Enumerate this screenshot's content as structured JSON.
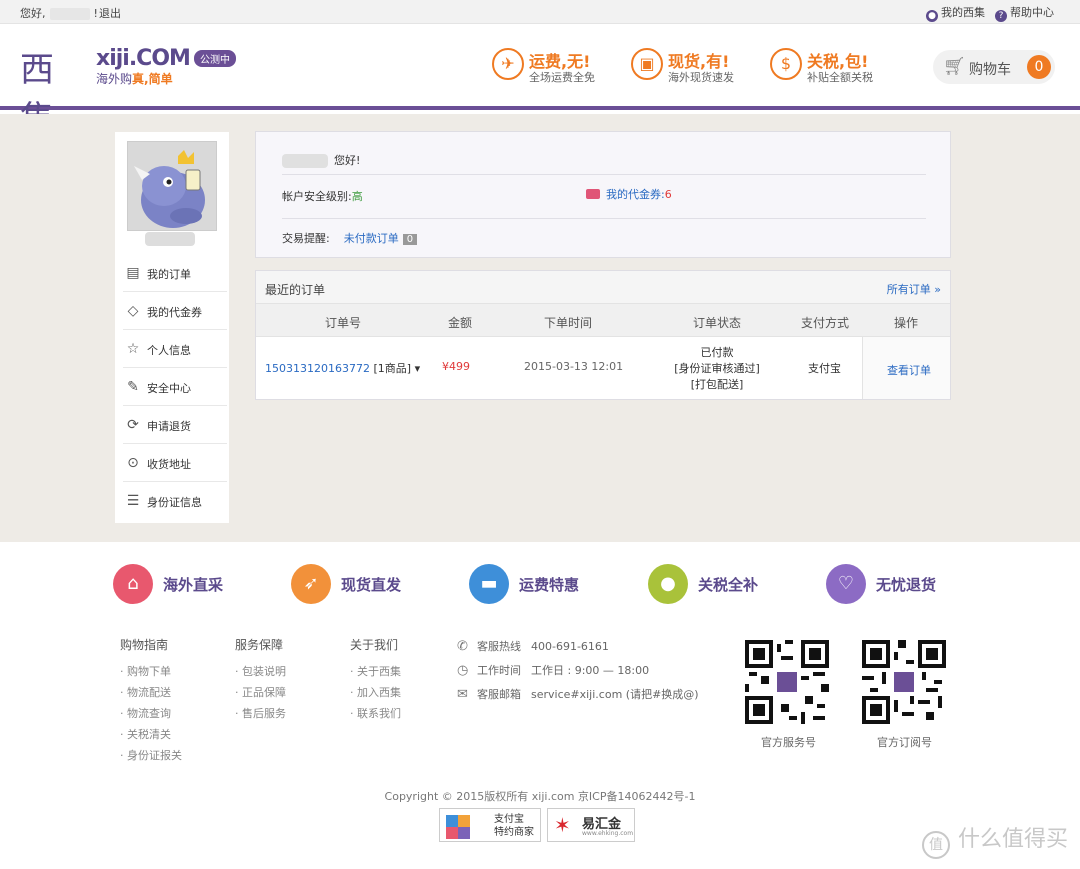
{
  "topbar": {
    "greeting": "您好,",
    "greeting_end": "!",
    "logout": "退出",
    "my_xiji": "我的西集",
    "help": "帮助中心"
  },
  "header": {
    "logo_cn": "西集",
    "logo_en": "xiji.COM",
    "slogan_a": "海外购",
    "slogan_b": "真,",
    "slogan_c": "简单",
    "beta": "公测中",
    "promos": [
      {
        "title": "运费,无!",
        "sub": "全场运费全免",
        "icon": "plane-icon"
      },
      {
        "title": "现货,有!",
        "sub": "海外现货速发",
        "icon": "gift-icon"
      },
      {
        "title": "关税,包!",
        "sub": "补贴全额关税",
        "icon": "money-icon"
      }
    ],
    "cart_label": "购物车",
    "cart_count": "0"
  },
  "sidebar": {
    "items": [
      {
        "label": "我的订单",
        "icon": "order-icon",
        "glyph": "▤"
      },
      {
        "label": "我的代金券",
        "icon": "coupon-tag-icon",
        "glyph": "◇"
      },
      {
        "label": "个人信息",
        "icon": "star-icon",
        "glyph": "☆"
      },
      {
        "label": "安全中心",
        "icon": "edit-icon",
        "glyph": "✎"
      },
      {
        "label": "申请退货",
        "icon": "refresh-icon",
        "glyph": "⟳"
      },
      {
        "label": "收货地址",
        "icon": "location-pin-icon",
        "glyph": "⊙"
      },
      {
        "label": "身份证信息",
        "icon": "id-card-icon",
        "glyph": "☰"
      }
    ]
  },
  "account": {
    "hello": "您好!",
    "security_label": "帐户安全级别:",
    "security_value": "高",
    "coupon_label": "我的代金券:",
    "coupon_value": "6",
    "remind_label": "交易提醒:",
    "unpaid_label": "未付款订单",
    "unpaid_count": "0"
  },
  "orders": {
    "title": "最近的订单",
    "all_link": "所有订单 »",
    "columns": [
      "订单号",
      "金额",
      "下单时间",
      "订单状态",
      "支付方式",
      "操作"
    ],
    "rows": [
      {
        "number": "150313120163772",
        "items": "[1商品]",
        "amount": "¥499",
        "time": "2015-03-13 12:01",
        "status": [
          "已付款",
          "[身份证审核通过]",
          "[打包配送]"
        ],
        "payment": "支付宝",
        "action": "查看订单"
      }
    ]
  },
  "features": [
    {
      "label": "海外直采",
      "color": "#e8586e",
      "icon": "bag-icon"
    },
    {
      "label": "现货直发",
      "color": "#f2913a",
      "icon": "rocket-icon"
    },
    {
      "label": "运费特惠",
      "color": "#3e8fd9",
      "icon": "truck-icon"
    },
    {
      "label": "关税全补",
      "color": "#a9c23a",
      "icon": "piggy-bank-icon"
    },
    {
      "label": "无忧退货",
      "color": "#8c6bc4",
      "icon": "return-icon"
    }
  ],
  "footer_links": [
    {
      "heading": "购物指南",
      "items": [
        "购物下单",
        "物流配送",
        "物流查询",
        "关税清关",
        "身份证报关"
      ]
    },
    {
      "heading": "服务保障",
      "items": [
        "包装说明",
        "正品保障",
        "售后服务"
      ]
    },
    {
      "heading": "关于我们",
      "items": [
        "关于西集",
        "加入西集",
        "联系我们"
      ]
    }
  ],
  "contact": {
    "hotline_label": "客服热线",
    "hotline": "400-691-6161",
    "hours_label": "工作时间",
    "hours": "工作日 : 9:00 — 18:00",
    "email_label": "客服邮箱",
    "email": "service#xiji.com (请把#换成@)"
  },
  "qr": {
    "service_label": "官方服务号",
    "subscribe_label": "官方订阅号"
  },
  "copyright": "Copyright © 2015版权所有 xiji.com 京ICP备14062442号-1",
  "badges": {
    "alipay_line1": "支付宝",
    "alipay_line2": "特约商家",
    "ehking": "易汇金",
    "ehking_site": "www.ehking.com"
  },
  "watermark": "什么值得买"
}
